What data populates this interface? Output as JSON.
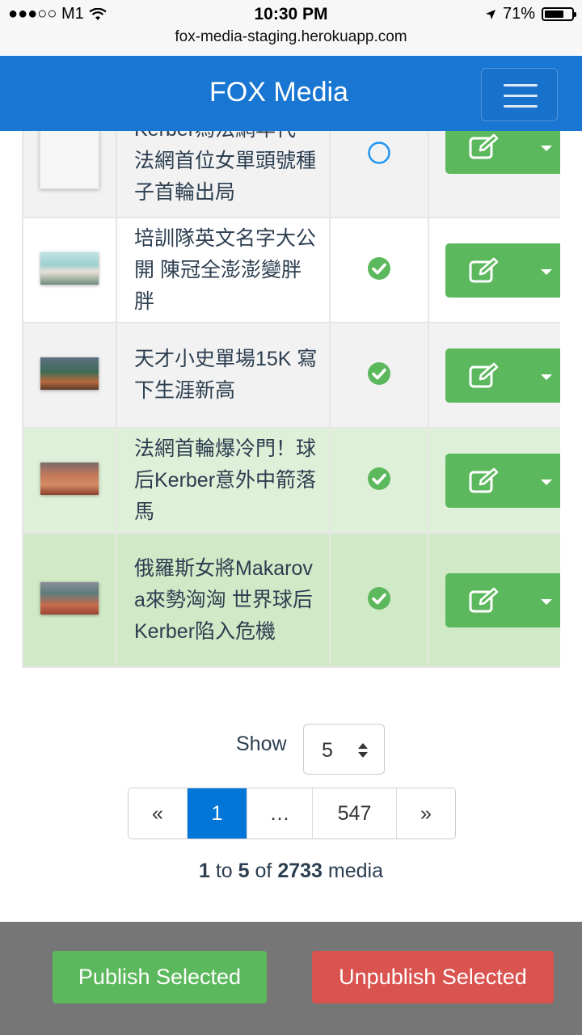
{
  "status_bar": {
    "carrier": "●●●○○ M1",
    "time": "10:30 PM",
    "battery_text": "71%",
    "battery_level": 0.71
  },
  "browser": {
    "url": "fox-media-staging.herokuapp.com"
  },
  "navbar": {
    "brand": "FOX Media",
    "menu_icon": "hamburger-icon"
  },
  "media_rows": [
    {
      "title": "Kerber為法網年代 法網首位女單頭號種子首輪出局",
      "published": false,
      "highlight": false,
      "row_bg": "#f2f2f2",
      "thumb": "blank",
      "edit_icon": "edit-icon",
      "dropdown_icon": "caret-down-icon"
    },
    {
      "title": "培訓隊英文名字大公開 陳冠全澎澎變胖胖",
      "published": true,
      "highlight": false,
      "row_bg": "#ffffff",
      "thumb": "image",
      "edit_icon": "edit-icon",
      "dropdown_icon": "caret-down-icon"
    },
    {
      "title": "天才小史單場15K 寫下生涯新高",
      "published": true,
      "highlight": false,
      "row_bg": "#f2f2f2",
      "thumb": "image",
      "edit_icon": "edit-icon",
      "dropdown_icon": "caret-down-icon"
    },
    {
      "title": "法網首輪爆冷門！球后Kerber意外中箭落馬",
      "published": true,
      "highlight": true,
      "row_bg": "#dff0d8",
      "thumb": "image",
      "edit_icon": "edit-icon",
      "dropdown_icon": "caret-down-icon"
    },
    {
      "title": "俄羅斯女將Makarova來勢洶洶 世界球后Kerber陷入危機",
      "published": true,
      "highlight": true,
      "row_bg": "#d0e9c6",
      "thumb": "image",
      "edit_icon": "edit-icon",
      "dropdown_icon": "caret-down-icon"
    }
  ],
  "show": {
    "label": "Show",
    "value": "5"
  },
  "pagination": {
    "prev": "«",
    "pages": [
      "1",
      "…",
      "547"
    ],
    "active_page": "1",
    "next": "»"
  },
  "summary": {
    "from": "1",
    "to_word": "to",
    "to": "5",
    "of_word": "of",
    "total": "2733",
    "unit": "media"
  },
  "footer": {
    "publish_label": "Publish Selected",
    "unpublish_label": "Unpublish Selected"
  },
  "colors": {
    "primary": "#1976d2",
    "success": "#5cb85c",
    "danger": "#d9534f",
    "active_page": "#0275d8",
    "unpublished_circle": "#2196f3"
  }
}
